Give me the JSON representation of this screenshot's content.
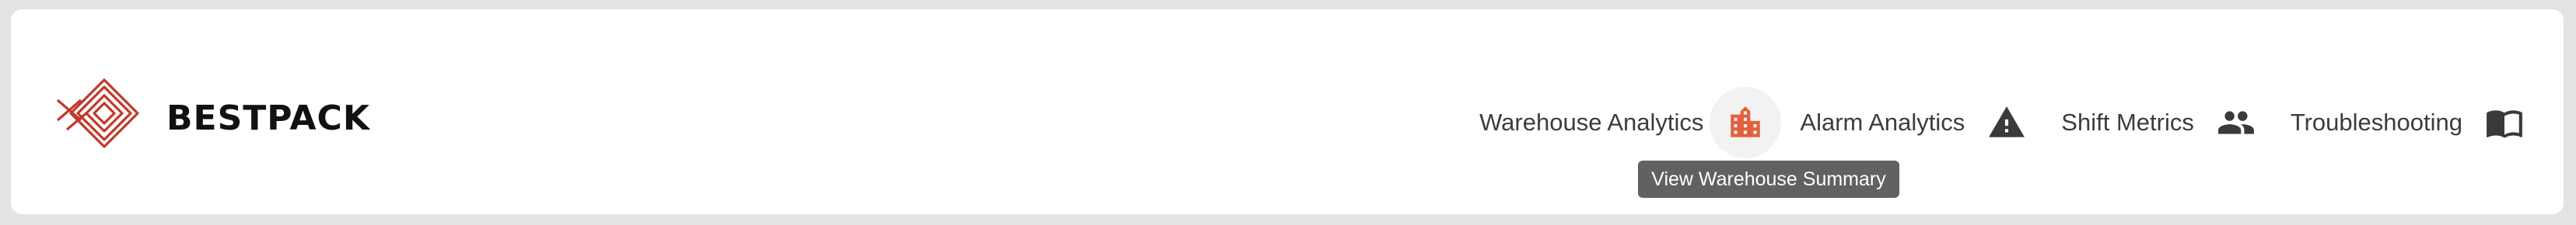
{
  "brand": {
    "name": "BESTPACK",
    "logo_icon": "bestpack-logo-icon",
    "accent_color": "#c0392b"
  },
  "nav": {
    "items": [
      {
        "label": "Warehouse Analytics",
        "icon": "warehouse-icon",
        "active": true,
        "icon_color": "#e45f3c"
      },
      {
        "label": "Alarm Analytics",
        "icon": "warning-icon",
        "active": false,
        "icon_color": "#3a3a3c"
      },
      {
        "label": "Shift Metrics",
        "icon": "people-icon",
        "active": false,
        "icon_color": "#3a3a3c"
      },
      {
        "label": "Troubleshooting",
        "icon": "book-icon",
        "active": false,
        "icon_color": "#3a3a3c"
      }
    ]
  },
  "tooltip": {
    "text": "View Warehouse Summary",
    "background": "#616161"
  }
}
